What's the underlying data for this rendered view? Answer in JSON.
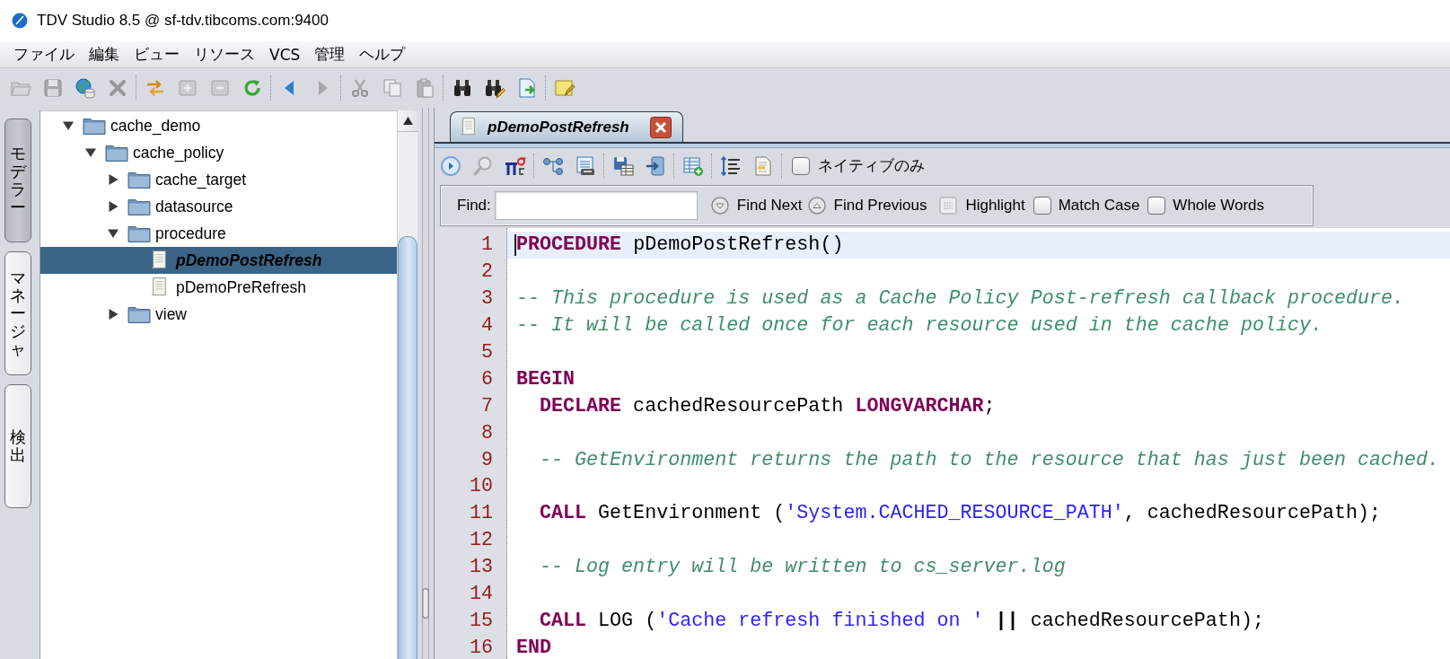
{
  "window": {
    "title": "TDV Studio 8.5 @ sf-tdv.tibcoms.com:9400"
  },
  "menu": [
    "ファイル",
    "編集",
    "ビュー",
    "リソース",
    "VCS",
    "管理",
    "ヘルプ"
  ],
  "toolbar": {
    "groups": [
      [
        {
          "disabled": true
        },
        {
          "disabled": true
        },
        {
          "disabled": false
        },
        {
          "disabled": true
        }
      ],
      [
        {
          "disabled": false
        },
        {
          "disabled": true
        },
        {
          "disabled": true
        },
        {
          "disabled": false
        }
      ],
      [
        {
          "disabled": false
        },
        {
          "disabled": true
        }
      ],
      [
        {
          "disabled": true
        },
        {
          "disabled": true
        },
        {
          "disabled": true
        }
      ],
      [
        {
          "disabled": false
        },
        {
          "disabled": false
        },
        {
          "disabled": false
        }
      ],
      [
        {
          "disabled": false
        }
      ]
    ]
  },
  "side_tabs": [
    {
      "label": "モデラー",
      "selected": true
    },
    {
      "label": "マネージャ",
      "selected": false
    },
    {
      "label": "検出",
      "selected": false
    }
  ],
  "tree": [
    {
      "label": "cache_demo",
      "kind": "folder",
      "expanded": true,
      "selected": false,
      "children": [
        {
          "label": "cache_policy",
          "kind": "folder",
          "expanded": true,
          "selected": false,
          "children": [
            {
              "label": "cache_target",
              "kind": "folder",
              "expanded": false,
              "selected": false
            },
            {
              "label": "datasource",
              "kind": "folder",
              "expanded": false,
              "selected": false
            },
            {
              "label": "procedure",
              "kind": "folder",
              "expanded": true,
              "selected": false,
              "children": [
                {
                  "label": "pDemoPostRefresh",
                  "kind": "procedure",
                  "selected": true
                },
                {
                  "label": "pDemoPreRefresh",
                  "kind": "procedure",
                  "selected": false
                }
              ]
            },
            {
              "label": "view",
              "kind": "folder",
              "expanded": false,
              "selected": false
            }
          ]
        }
      ]
    }
  ],
  "editor_tabs": [
    {
      "label": "pDemoPostRefresh",
      "selected": true
    }
  ],
  "editor_toolbar": {
    "groups": [
      [
        {
          "disabled": false
        },
        {
          "disabled": true
        },
        {
          "disabled": false
        }
      ],
      [
        {
          "disabled": false
        },
        {
          "disabled": false
        }
      ],
      [
        {
          "disabled": false
        },
        {
          "disabled": false
        }
      ],
      [
        {
          "disabled": false
        }
      ],
      [
        {
          "disabled": false
        },
        {
          "disabled": false
        }
      ]
    ],
    "native_only": {
      "label": "ネイティブのみ",
      "checked": false
    }
  },
  "find_bar": {
    "label": "Find:",
    "buttons": [
      {
        "kind": "next",
        "label": "Find Next"
      },
      {
        "kind": "previous",
        "label": "Find Previous"
      },
      {
        "kind": "highlight",
        "label": "Highlight"
      }
    ],
    "options": [
      {
        "label": "Match Case",
        "checked": false
      },
      {
        "label": "Whole Words",
        "checked": false
      }
    ]
  },
  "editor": {
    "lines": [
      {
        "number": "1",
        "current": true,
        "segments": [
          {
            "kind": "keyword",
            "text": "PROCEDURE"
          },
          {
            "kind": "plain",
            "text": " pDemoPostRefresh()"
          }
        ]
      },
      {
        "number": "2",
        "current": false
      },
      {
        "number": "3",
        "current": false,
        "segments": [
          {
            "kind": "comment",
            "text": "-- This procedure is used as a Cache Policy Post-refresh callback procedure."
          }
        ]
      },
      {
        "number": "4",
        "current": false,
        "segments": [
          {
            "kind": "comment",
            "text": "-- It will be called once for each resource used in the cache policy."
          }
        ]
      },
      {
        "number": "5",
        "current": false
      },
      {
        "number": "6",
        "current": false,
        "segments": [
          {
            "kind": "keyword",
            "text": "BEGIN"
          }
        ],
        "children": [
          {
            "number": "7",
            "current": false,
            "segments": [
              {
                "kind": "keyword",
                "text": "DECLARE"
              },
              {
                "kind": "plain",
                "text": " cachedResourcePath "
              },
              {
                "kind": "keyword",
                "text": "LONGVARCHAR"
              },
              {
                "kind": "plain",
                "text": ";"
              }
            ]
          },
          {
            "number": "8",
            "current": false
          },
          {
            "number": "9",
            "current": false,
            "segments": [
              {
                "kind": "comment",
                "text": "-- GetEnvironment returns the path to the resource that has just been cached."
              }
            ]
          },
          {
            "number": "10",
            "current": false
          },
          {
            "number": "11",
            "current": false,
            "segments": [
              {
                "kind": "keyword",
                "text": "CALL"
              },
              {
                "kind": "plain",
                "text": " GetEnvironment ("
              },
              {
                "kind": "string",
                "text": "'System.CACHED_RESOURCE_PATH'"
              },
              {
                "kind": "plain",
                "text": ", cachedResourcePath);"
              }
            ]
          },
          {
            "number": "12",
            "current": false
          },
          {
            "number": "13",
            "current": false,
            "segments": [
              {
                "kind": "comment",
                "text": "-- Log entry will be written to cs_server.log"
              }
            ]
          },
          {
            "number": "14",
            "current": false
          },
          {
            "number": "15",
            "current": false,
            "segments": [
              {
                "kind": "keyword",
                "text": "CALL"
              },
              {
                "kind": "plain",
                "text": " LOG ("
              },
              {
                "kind": "string",
                "text": "'Cache refresh finished on '"
              },
              {
                "kind": "operator",
                "text": " ||"
              },
              {
                "kind": "plain",
                "text": " cachedResourcePath);"
              }
            ]
          }
        ]
      },
      {
        "number": "16",
        "current": false,
        "segments": [
          {
            "kind": "keyword",
            "text": "END"
          }
        ]
      }
    ]
  }
}
